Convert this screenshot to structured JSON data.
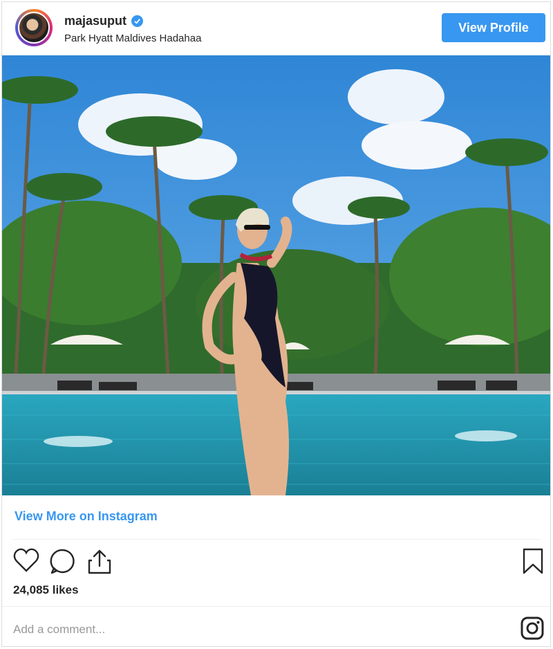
{
  "post": {
    "username": "majasuput",
    "location": "Park Hyatt Maldives Hadahaa",
    "view_profile_label": "View Profile",
    "view_more_label": "View More on Instagram",
    "likes": "24,085 likes",
    "comment_placeholder": "Add a comment..."
  },
  "icons": {
    "verified": "verified-badge-icon",
    "like": "heart-icon",
    "comment": "speech-bubble-icon",
    "share": "share-icon",
    "save": "bookmark-icon",
    "instagram": "instagram-logo-icon"
  },
  "colors": {
    "accent": "#3897f0",
    "text": "#262626",
    "muted": "#999999",
    "border": "#dbdbdb"
  }
}
